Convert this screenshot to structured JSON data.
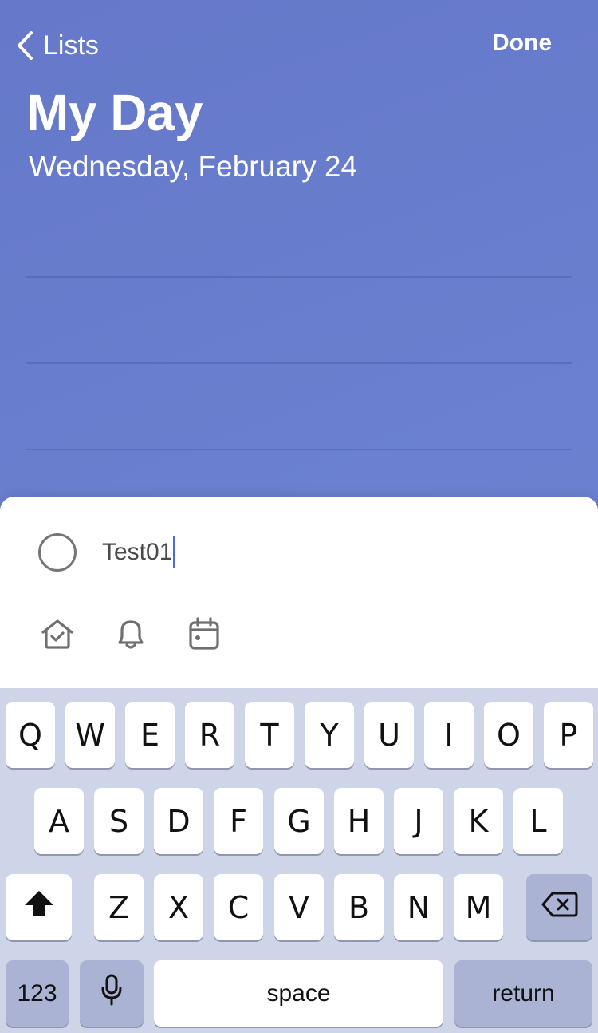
{
  "header": {
    "back_label": "Lists",
    "done_label": "Done",
    "title": "My Day",
    "subtitle": "Wednesday, February 24"
  },
  "task_entry": {
    "value": "Test01",
    "icons": [
      "add-to-my-day-icon",
      "reminder-bell-icon",
      "due-date-calendar-icon"
    ]
  },
  "keyboard": {
    "row1": [
      "Q",
      "W",
      "E",
      "R",
      "T",
      "Y",
      "U",
      "I",
      "O",
      "P"
    ],
    "row2": [
      "A",
      "S",
      "D",
      "F",
      "G",
      "H",
      "J",
      "K",
      "L"
    ],
    "row3": [
      "Z",
      "X",
      "C",
      "V",
      "B",
      "N",
      "M"
    ],
    "numbers_label": "123",
    "space_label": "space",
    "return_label": "return"
  },
  "colors": {
    "background": "#6a7fce",
    "caret": "#4f6bd8",
    "keyboard_bg": "#cfd5e8"
  }
}
